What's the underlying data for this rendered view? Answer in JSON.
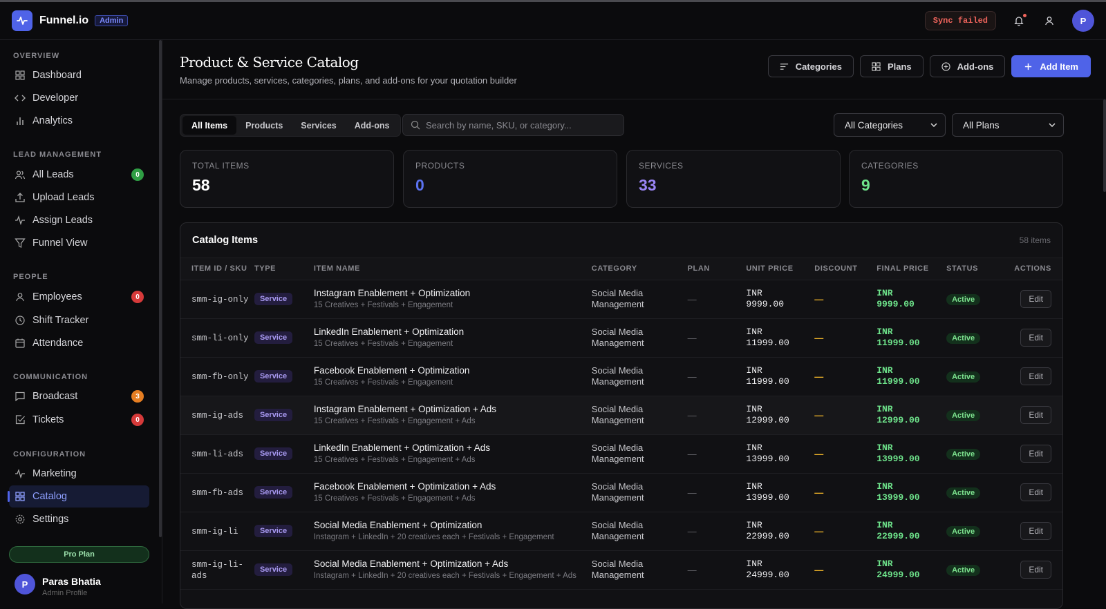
{
  "app": {
    "brand": "Funnel.io",
    "role_badge": "Admin",
    "sync_status": "Sync failed",
    "user_initial": "P"
  },
  "sidebar": {
    "sections": {
      "overview": "OVERVIEW",
      "lead": "LEAD MANAGEMENT",
      "people": "PEOPLE",
      "communication": "COMMUNICATION",
      "configuration": "CONFIGURATION"
    },
    "items": {
      "dashboard": "Dashboard",
      "developer": "Developer",
      "analytics": "Analytics",
      "all_leads": "All Leads",
      "all_leads_count": "0",
      "upload_leads": "Upload Leads",
      "assign_leads": "Assign Leads",
      "funnel_view": "Funnel View",
      "employees": "Employees",
      "employees_count": "0",
      "shift_tracker": "Shift Tracker",
      "attendance": "Attendance",
      "broadcast": "Broadcast",
      "broadcast_count": "3",
      "tickets": "Tickets",
      "tickets_count": "0",
      "marketing": "Marketing",
      "catalog": "Catalog",
      "settings": "Settings"
    },
    "plan": "Pro Plan",
    "user": {
      "initial": "P",
      "name": "Paras Bhatia",
      "role": "Admin Profile"
    }
  },
  "header": {
    "title": "Product & Service Catalog",
    "subtitle": "Manage products, services, categories, plans, and add-ons for your quotation builder",
    "buttons": {
      "categories": "Categories",
      "plans": "Plans",
      "addons": "Add-ons",
      "add_item": "Add Item"
    }
  },
  "filters": {
    "tabs": {
      "all": "All Items",
      "products": "Products",
      "services": "Services",
      "addons": "Add-ons"
    },
    "search_placeholder": "Search by name, SKU, or category...",
    "category_select": "All Categories",
    "plan_select": "All Plans"
  },
  "stats": {
    "total": {
      "label": "TOTAL ITEMS",
      "value": "58",
      "color": "#ffffff"
    },
    "products": {
      "label": "PRODUCTS",
      "value": "0",
      "color": "#5b72f0"
    },
    "services": {
      "label": "SERVICES",
      "value": "33",
      "color": "#9a85f5"
    },
    "categories": {
      "label": "CATEGORIES",
      "value": "9",
      "color": "#6ee38b"
    }
  },
  "catalog": {
    "title": "Catalog Items",
    "count": "58 items",
    "columns": [
      "ITEM ID / SKU",
      "TYPE",
      "ITEM NAME",
      "CATEGORY",
      "PLAN",
      "UNIT PRICE",
      "DISCOUNT",
      "FINAL PRICE",
      "STATUS",
      "ACTIONS"
    ],
    "rows": [
      {
        "sku": "smm-ig-only",
        "type": "Service",
        "name": "Instagram Enablement + Optimization",
        "desc": "15 Creatives + Festivals + Engagement",
        "cat1": "Social Media",
        "cat2": "Management",
        "plan": "—",
        "currency": "INR",
        "unit": "9999.00",
        "discount": "—",
        "final": "9999.00",
        "status": "Active",
        "action": "Edit"
      },
      {
        "sku": "smm-li-only",
        "type": "Service",
        "name": "LinkedIn Enablement + Optimization",
        "desc": "15 Creatives + Festivals + Engagement",
        "cat1": "Social Media",
        "cat2": "Management",
        "plan": "—",
        "currency": "INR",
        "unit": "11999.00",
        "discount": "—",
        "final": "11999.00",
        "status": "Active",
        "action": "Edit"
      },
      {
        "sku": "smm-fb-only",
        "type": "Service",
        "name": "Facebook Enablement + Optimization",
        "desc": "15 Creatives + Festivals + Engagement",
        "cat1": "Social Media",
        "cat2": "Management",
        "plan": "—",
        "currency": "INR",
        "unit": "11999.00",
        "discount": "—",
        "final": "11999.00",
        "status": "Active",
        "action": "Edit"
      },
      {
        "sku": "smm-ig-ads",
        "type": "Service",
        "name": "Instagram Enablement + Optimization + Ads",
        "desc": "15 Creatives + Festivals + Engagement + Ads",
        "cat1": "Social Media",
        "cat2": "Management",
        "plan": "—",
        "currency": "INR",
        "unit": "12999.00",
        "discount": "—",
        "final": "12999.00",
        "status": "Active",
        "action": "Edit"
      },
      {
        "sku": "smm-li-ads",
        "type": "Service",
        "name": "LinkedIn Enablement + Optimization + Ads",
        "desc": "15 Creatives + Festivals + Engagement + Ads",
        "cat1": "Social Media",
        "cat2": "Management",
        "plan": "—",
        "currency": "INR",
        "unit": "13999.00",
        "discount": "—",
        "final": "13999.00",
        "status": "Active",
        "action": "Edit"
      },
      {
        "sku": "smm-fb-ads",
        "type": "Service",
        "name": "Facebook Enablement + Optimization + Ads",
        "desc": "15 Creatives + Festivals + Engagement + Ads",
        "cat1": "Social Media",
        "cat2": "Management",
        "plan": "—",
        "currency": "INR",
        "unit": "13999.00",
        "discount": "—",
        "final": "13999.00",
        "status": "Active",
        "action": "Edit"
      },
      {
        "sku": "smm-ig-li",
        "type": "Service",
        "name": "Social Media Enablement + Optimization",
        "desc": "Instagram + LinkedIn + 20 creatives each + Festivals + Engagement",
        "cat1": "Social Media",
        "cat2": "Management",
        "plan": "—",
        "currency": "INR",
        "unit": "22999.00",
        "discount": "—",
        "final": "22999.00",
        "status": "Active",
        "action": "Edit"
      },
      {
        "sku": "smm-ig-li-ads",
        "type": "Service",
        "name": "Social Media Enablement + Optimization + Ads",
        "desc": "Instagram + LinkedIn + 20 creatives each + Festivals + Engagement + Ads",
        "cat1": "Social Media",
        "cat2": "Management",
        "plan": "—",
        "currency": "INR",
        "unit": "24999.00",
        "discount": "—",
        "final": "24999.00",
        "status": "Active",
        "action": "Edit"
      }
    ]
  }
}
